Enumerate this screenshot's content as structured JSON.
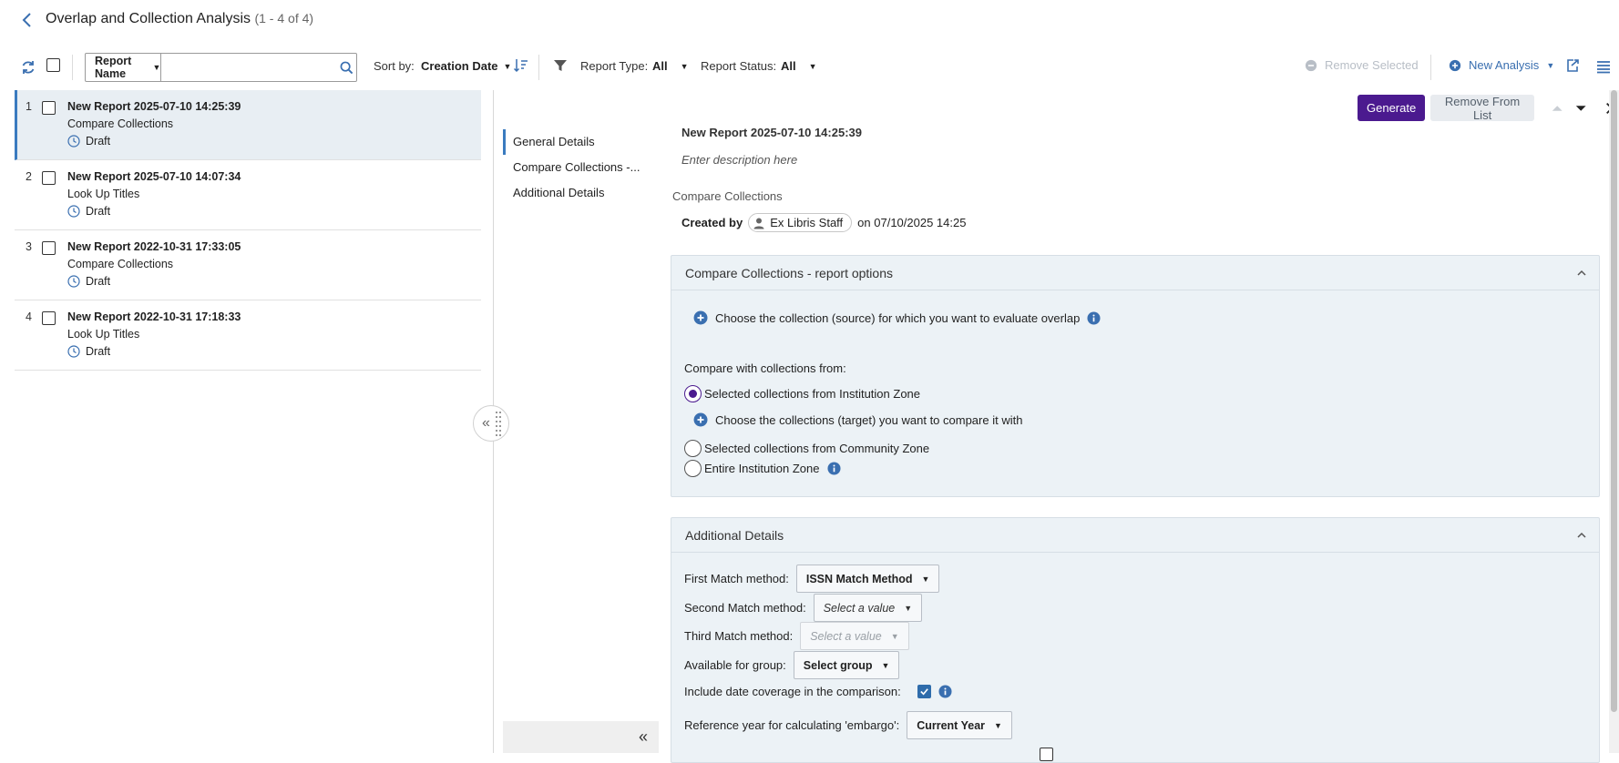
{
  "header": {
    "title": "Overlap and Collection Analysis",
    "count": "(1 - 4 of 4)"
  },
  "toolbar": {
    "search_field": "Report Name",
    "search_placeholder": "",
    "sort_label": "Sort by:",
    "sort_value": "Creation Date",
    "report_type_label": "Report Type:",
    "report_type_value": "All",
    "report_status_label": "Report Status:",
    "report_status_value": "All",
    "remove_selected": "Remove Selected",
    "new_analysis": "New Analysis"
  },
  "reports": [
    {
      "num": "1",
      "title": "New Report 2025-07-10 14:25:39",
      "type": "Compare Collections",
      "status": "Draft"
    },
    {
      "num": "2",
      "title": "New Report 2025-07-10 14:07:34",
      "type": "Look Up Titles",
      "status": "Draft"
    },
    {
      "num": "3",
      "title": "New Report 2022-10-31 17:33:05",
      "type": "Compare Collections",
      "status": "Draft"
    },
    {
      "num": "4",
      "title": "New Report 2022-10-31 17:18:33",
      "type": "Look Up Titles",
      "status": "Draft"
    }
  ],
  "detail_nav": {
    "items": [
      "General Details",
      "Compare Collections -...",
      "Additional Details"
    ]
  },
  "actions": {
    "generate": "Generate",
    "remove_from_list": "Remove From List"
  },
  "detail": {
    "report_name": "New Report 2025-07-10 14:25:39",
    "description_placeholder": "Enter description here",
    "report_type": "Compare Collections",
    "created_by_label": "Created by",
    "created_by_user": "Ex Libris Staff",
    "created_on": "on 07/10/2025 14:25"
  },
  "options_panel": {
    "title": "Compare Collections - report options",
    "choose_source": "Choose the collection (source) for which you want to evaluate overlap",
    "compare_with_label": "Compare with collections from:",
    "radio_institution": "Selected collections from Institution Zone",
    "choose_target": "Choose the collections (target) you want to compare it with",
    "radio_community": "Selected collections from Community Zone",
    "radio_entire": "Entire Institution Zone"
  },
  "additional_panel": {
    "title": "Additional Details",
    "first_match_label": "First Match method:",
    "first_match_value": "ISSN Match Method",
    "second_match_label": "Second Match method:",
    "second_match_value": "Select a value",
    "third_match_label": "Third Match method:",
    "third_match_value": "Select a value",
    "group_label": "Available for group:",
    "group_value": "Select group",
    "date_coverage_label": "Include date coverage in the comparison:",
    "embargo_label": "Reference year for calculating 'embargo':",
    "embargo_value": "Current Year"
  },
  "colors": {
    "accent": "#3a6fb0",
    "primary_button": "#4b1a8f",
    "panel_bg": "#ecf2f6",
    "selected_row": "#e8eef3"
  }
}
